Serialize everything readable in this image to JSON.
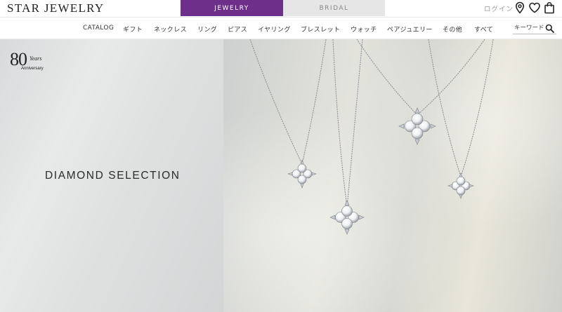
{
  "brand": {
    "logo_text": "Star Jewelry"
  },
  "tabs": [
    {
      "label": "JEWELRY",
      "active": true
    },
    {
      "label": "BRIDAL",
      "active": false
    }
  ],
  "account": {
    "login_label": "ログイン"
  },
  "header_icons": [
    "map-pin-icon",
    "heart-icon",
    "shopping-bag-icon"
  ],
  "nav": {
    "items": [
      {
        "label": "CATALOG"
      },
      {
        "label": "ギフト"
      },
      {
        "label": "ネックレス"
      },
      {
        "label": "リング"
      },
      {
        "label": "ピアス"
      },
      {
        "label": "イヤリング"
      },
      {
        "label": "ブレスレット"
      },
      {
        "label": "ウォッチ"
      },
      {
        "label": "ペアジュエリー"
      },
      {
        "label": "その他"
      },
      {
        "label": "すべて"
      }
    ]
  },
  "search": {
    "placeholder": "キーワード",
    "value": ""
  },
  "hero": {
    "badge": {
      "number": "80",
      "years": "Years",
      "anniversary": "Anniversary"
    },
    "title": "DIAMOND SELECTION"
  },
  "colors": {
    "accent": "#6e2f8a",
    "tab_inactive": "#e6e6e6",
    "text": "#333333"
  }
}
